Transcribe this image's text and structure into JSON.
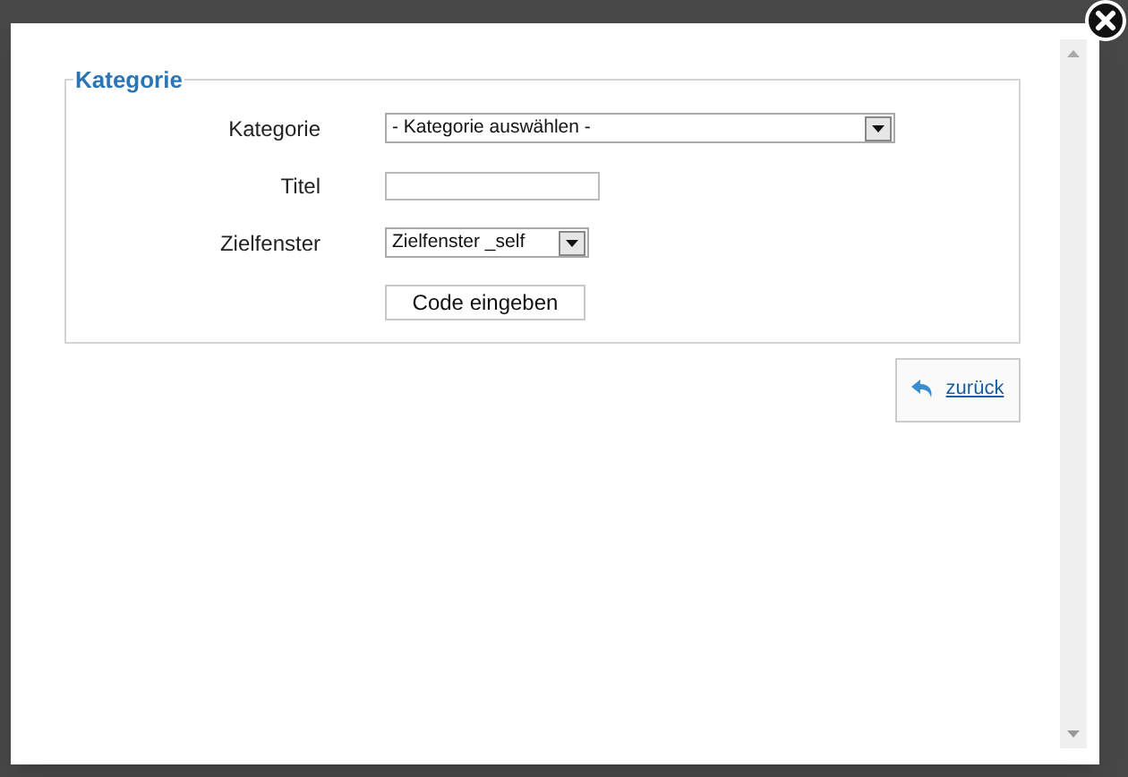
{
  "dialog": {
    "legend": "Kategorie",
    "fields": [
      {
        "kind": "select",
        "label": "Kategorie",
        "value": "- Kategorie auswählen -"
      },
      {
        "kind": "text",
        "label": "Titel"
      },
      {
        "kind": "select",
        "label": "Zielfenster",
        "value": "Zielfenster _self"
      }
    ],
    "submit_button": "Code eingeben",
    "back_link": "zurück"
  }
}
